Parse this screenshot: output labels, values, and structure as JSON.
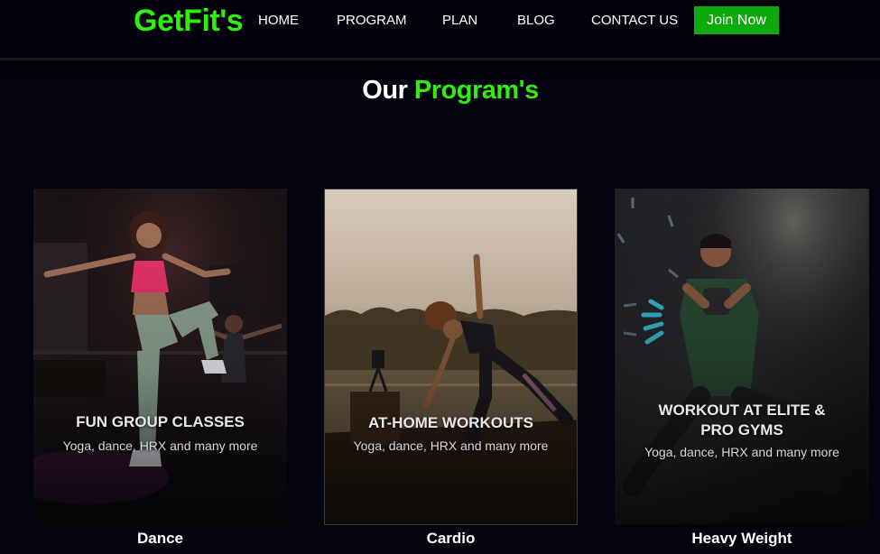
{
  "brand": {
    "logo": "GetFit's"
  },
  "nav": {
    "items": [
      {
        "label": "HOME"
      },
      {
        "label": "PROGRAM"
      },
      {
        "label": "PLAN"
      },
      {
        "label": "BLOG"
      },
      {
        "label": "CONTACT US"
      }
    ],
    "cta_label": "Join Now"
  },
  "section": {
    "title_part1": "Our",
    "title_part2": "Program's"
  },
  "programs": [
    {
      "heading": "FUN GROUP CLASSES",
      "subtext": "Yoga, dance, HRX and many more",
      "label": "Dance"
    },
    {
      "heading": "AT-HOME WORKOUTS",
      "subtext": "Yoga, dance, HRX and many more",
      "label": "Cardio"
    },
    {
      "heading_line1": "WORKOUT AT ELITE &",
      "heading_line2": "PRO GYMS",
      "subtext": "Yoga, dance, HRX and many more",
      "label": "Heavy Weight"
    }
  ],
  "colors": {
    "background": "#03030f",
    "accent": "#2ef00a",
    "cta": "#0eaa0c"
  }
}
